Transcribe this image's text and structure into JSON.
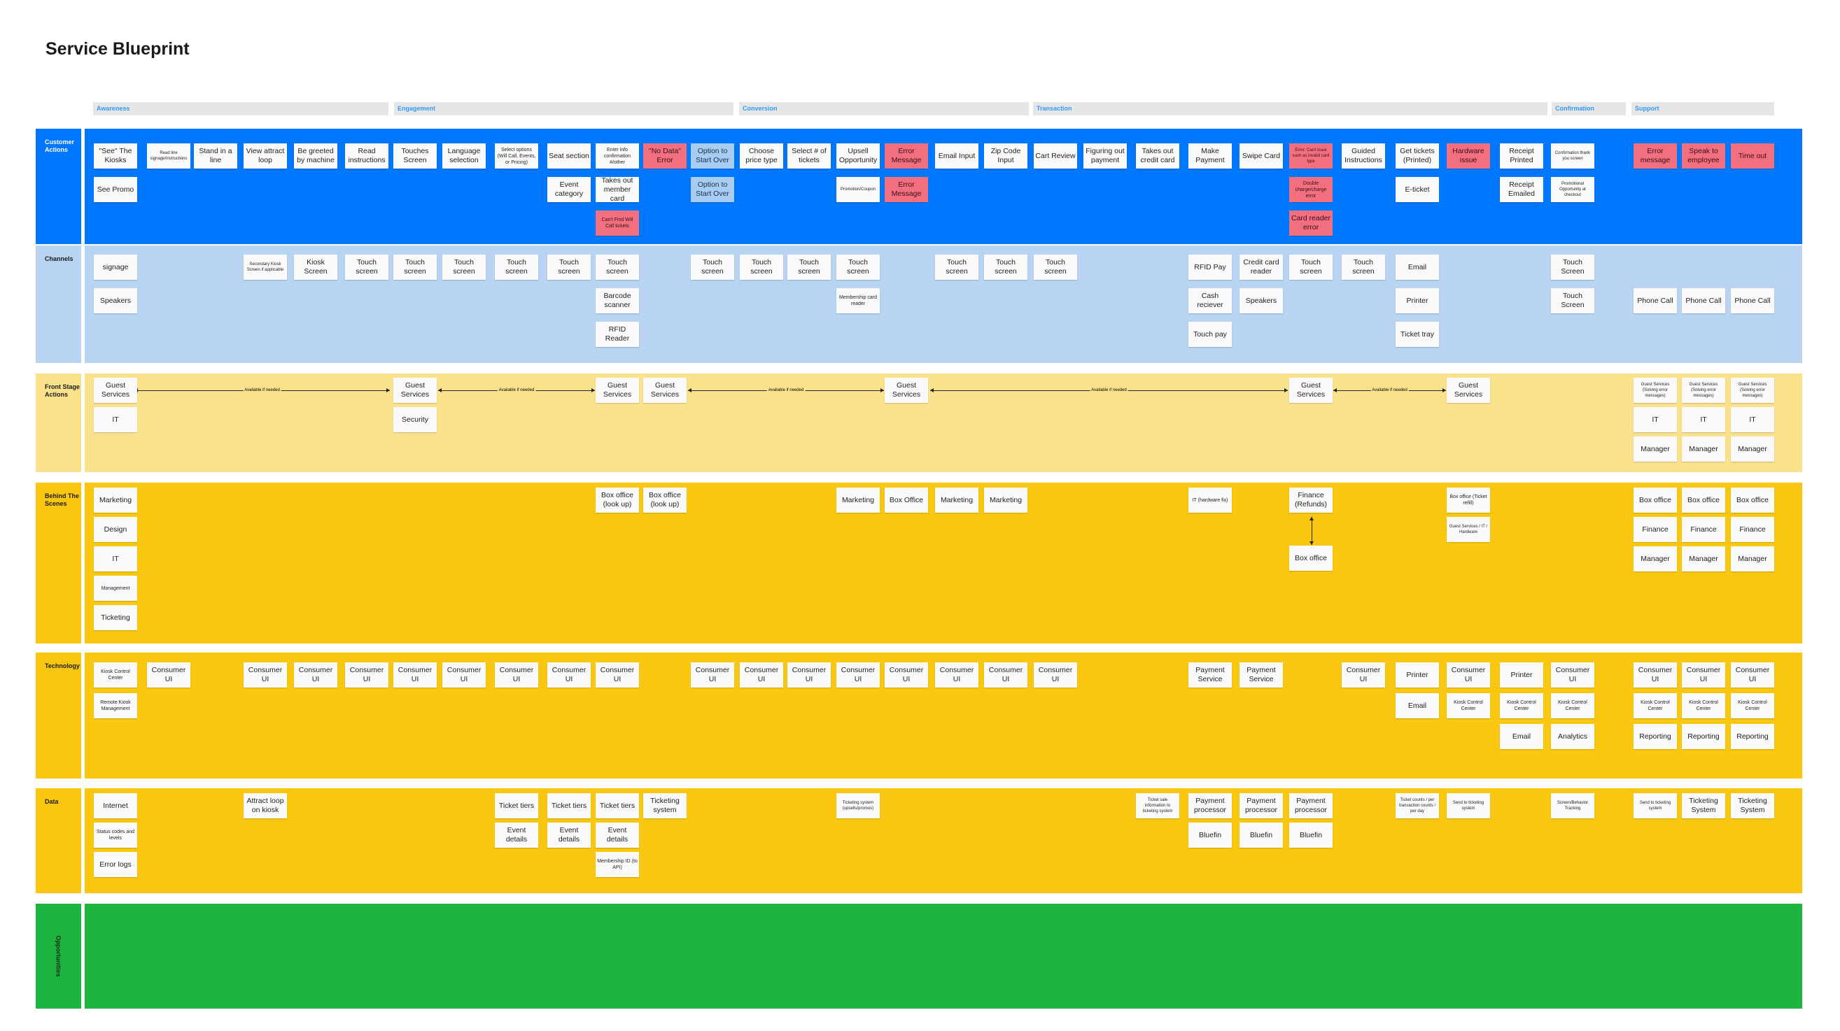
{
  "title": "Service Blueprint",
  "colors": {
    "customer_actions": "#0077ff",
    "channels": "#b9d3f2",
    "front_stage": "#fae28c",
    "behind_the_scenes": "#f9c710",
    "technology": "#f9c710",
    "data": "#f9c710",
    "opportunities": "#1db53f",
    "phase_bar": "#e6e6e6",
    "phase_text": "#2f9bff",
    "error_note": "#f26f80",
    "alt_note": "#a8cdf5"
  },
  "phases": [
    {
      "label": "Awareness"
    },
    {
      "label": "Engagement"
    },
    {
      "label": "Conversion"
    },
    {
      "label": "Transaction"
    },
    {
      "label": "Confirmation"
    },
    {
      "label": "Support"
    }
  ],
  "lanes": [
    {
      "key": "customer_actions",
      "label": "Customer Actions"
    },
    {
      "key": "channels",
      "label": "Channels"
    },
    {
      "key": "front_stage",
      "label": "Front Stage Actions"
    },
    {
      "key": "behind_the_scenes",
      "label": "Behind The Scenes"
    },
    {
      "key": "technology",
      "label": "Technology"
    },
    {
      "key": "data",
      "label": "Data"
    },
    {
      "key": "opportunities",
      "label": "Opportunities"
    }
  ],
  "connector_label": "Available if needed",
  "notes": {
    "customer_actions": [
      {
        "col": 0,
        "row": 0,
        "text": "\"See\" The Kiosks"
      },
      {
        "col": 0,
        "row": 1,
        "text": "See Promo"
      },
      {
        "col": 1,
        "row": 0,
        "text": "Read line signage/instructions",
        "size": "tiny"
      },
      {
        "col": 2,
        "row": 0,
        "text": "Stand in a line"
      },
      {
        "col": 3,
        "row": 0,
        "text": "View attract loop"
      },
      {
        "col": 4,
        "row": 0,
        "text": "Be greeted by machine"
      },
      {
        "col": 5,
        "row": 0,
        "text": "Read instructions"
      },
      {
        "col": 6,
        "row": 0,
        "text": "Touches Screen"
      },
      {
        "col": 7,
        "row": 0,
        "text": "Language selection"
      },
      {
        "col": 8,
        "row": 0,
        "text": "Select options (Will Call, Events, or Pricing)",
        "size": "small"
      },
      {
        "col": 9,
        "row": 0,
        "text": "Seat section"
      },
      {
        "col": 9,
        "row": 1,
        "text": "Event category"
      },
      {
        "col": 10,
        "row": 0,
        "text": "Enter info confirmation #/other",
        "size": "small"
      },
      {
        "col": 10,
        "row": 1,
        "text": "Takes out member card"
      },
      {
        "col": 10,
        "row": 2,
        "text": "Can't Find Will Call tickets",
        "type": "error",
        "size": "small"
      },
      {
        "col": 11,
        "row": 0,
        "text": "\"No Data\" Error",
        "type": "error"
      },
      {
        "col": 12,
        "row": 0,
        "text": "Option to Start Over",
        "type": "alt"
      },
      {
        "col": 12,
        "row": 1,
        "text": "Option to Start Over",
        "type": "alt"
      },
      {
        "col": 13,
        "row": 0,
        "text": "Choose price type"
      },
      {
        "col": 14,
        "row": 0,
        "text": "Select # of tickets"
      },
      {
        "col": 15,
        "row": 0,
        "text": "Upsell Opportunity"
      },
      {
        "col": 15,
        "row": 1,
        "text": "Promotion/Coupon",
        "size": "tiny"
      },
      {
        "col": 16,
        "row": 0,
        "text": "Error Message",
        "type": "error"
      },
      {
        "col": 16,
        "row": 1,
        "text": "Error Message",
        "type": "error"
      },
      {
        "col": 17,
        "row": 0,
        "text": "Email Input"
      },
      {
        "col": 18,
        "row": 0,
        "text": "Zip Code Input"
      },
      {
        "col": 19,
        "row": 0,
        "text": "Cart Review"
      },
      {
        "col": 20,
        "row": 0,
        "text": "Figuring out payment"
      },
      {
        "col": 21,
        "row": 0,
        "text": "Takes out credit card"
      },
      {
        "col": 22,
        "row": 0,
        "text": "Make Payment"
      },
      {
        "col": 23,
        "row": 0,
        "text": "Swipe Card"
      },
      {
        "col": 24,
        "row": 0,
        "text": "Error: Card issue such as invalid card type",
        "type": "error",
        "size": "tiny"
      },
      {
        "col": 24,
        "row": 1,
        "text": "Double charge/charge error",
        "type": "error",
        "size": "small"
      },
      {
        "col": 24,
        "row": 2,
        "text": "Card reader error",
        "type": "error"
      },
      {
        "col": 25,
        "row": 0,
        "text": "Guided Instructions"
      },
      {
        "col": 26,
        "row": 0,
        "text": "Get tickets (Printed)"
      },
      {
        "col": 26,
        "row": 1,
        "text": "E-ticket"
      },
      {
        "col": 27,
        "row": 0,
        "text": "Hardware issue",
        "type": "error"
      },
      {
        "col": 28,
        "row": 0,
        "text": "Receipt Printed"
      },
      {
        "col": 28,
        "row": 1,
        "text": "Receipt Emailed"
      },
      {
        "col": 29,
        "row": 0,
        "text": "Confirmation thank you screen",
        "size": "tiny"
      },
      {
        "col": 29,
        "row": 1,
        "text": "Promotional Opportunity at checkout",
        "size": "tiny"
      },
      {
        "col": 30,
        "row": 0,
        "text": "Error message",
        "type": "error"
      },
      {
        "col": 31,
        "row": 0,
        "text": "Speak to employee",
        "type": "error"
      },
      {
        "col": 32,
        "row": 0,
        "text": "Time out",
        "type": "error"
      }
    ],
    "channels": [
      {
        "col": 0,
        "row": 0,
        "text": "signage"
      },
      {
        "col": 0,
        "row": 1,
        "text": "Speakers"
      },
      {
        "col": 3,
        "row": 0,
        "text": "Secondary Kiosk Screen if applicable",
        "size": "tiny"
      },
      {
        "col": 4,
        "row": 0,
        "text": "Kiosk Screen"
      },
      {
        "col": 5,
        "row": 0,
        "text": "Touch screen"
      },
      {
        "col": 6,
        "row": 0,
        "text": "Touch screen"
      },
      {
        "col": 7,
        "row": 0,
        "text": "Touch screen"
      },
      {
        "col": 8,
        "row": 0,
        "text": "Touch screen"
      },
      {
        "col": 9,
        "row": 0,
        "text": "Touch screen"
      },
      {
        "col": 10,
        "row": 0,
        "text": "Touch screen"
      },
      {
        "col": 10,
        "row": 1,
        "text": "Barcode scanner"
      },
      {
        "col": 10,
        "row": 2,
        "text": "RFID Reader"
      },
      {
        "col": 12,
        "row": 0,
        "text": "Touch screen"
      },
      {
        "col": 13,
        "row": 0,
        "text": "Touch screen"
      },
      {
        "col": 14,
        "row": 0,
        "text": "Touch screen"
      },
      {
        "col": 15,
        "row": 0,
        "text": "Touch screen"
      },
      {
        "col": 15,
        "row": 1,
        "text": "Membership card reader",
        "size": "small"
      },
      {
        "col": 17,
        "row": 0,
        "text": "Touch screen"
      },
      {
        "col": 18,
        "row": 0,
        "text": "Touch screen"
      },
      {
        "col": 19,
        "row": 0,
        "text": "Touch screen"
      },
      {
        "col": 22,
        "row": 0,
        "text": "RFID Pay"
      },
      {
        "col": 22,
        "row": 1,
        "text": "Cash reciever"
      },
      {
        "col": 22,
        "row": 2,
        "text": "Touch pay"
      },
      {
        "col": 23,
        "row": 0,
        "text": "Credit card reader"
      },
      {
        "col": 23,
        "row": 1,
        "text": "Speakers"
      },
      {
        "col": 24,
        "row": 0,
        "text": "Touch screen"
      },
      {
        "col": 25,
        "row": 0,
        "text": "Touch screen"
      },
      {
        "col": 26,
        "row": 0,
        "text": "Email"
      },
      {
        "col": 26,
        "row": 1,
        "text": "Printer"
      },
      {
        "col": 26,
        "row": 2,
        "text": "Ticket tray"
      },
      {
        "col": 29,
        "row": 0,
        "text": "Touch Screen"
      },
      {
        "col": 29,
        "row": 1,
        "text": "Touch Screen"
      },
      {
        "col": 30,
        "row": 1,
        "text": "Phone Call"
      },
      {
        "col": 31,
        "row": 1,
        "text": "Phone Call"
      },
      {
        "col": 32,
        "row": 1,
        "text": "Phone Call"
      }
    ],
    "front_stage": [
      {
        "col": 0,
        "row": 0,
        "text": "Guest Services"
      },
      {
        "col": 0,
        "row": 1,
        "text": "IT"
      },
      {
        "col": 6,
        "row": 0,
        "text": "Guest Services"
      },
      {
        "col": 6,
        "row": 1,
        "text": "Security"
      },
      {
        "col": 10,
        "row": 0,
        "text": "Guest Services"
      },
      {
        "col": 11,
        "row": 0,
        "text": "Guest Services"
      },
      {
        "col": 16,
        "row": 0,
        "text": "Guest Services"
      },
      {
        "col": 24,
        "row": 0,
        "text": "Guest Services"
      },
      {
        "col": 27,
        "row": 0,
        "text": "Guest Services"
      },
      {
        "col": 30,
        "row": 0,
        "text": "Guest Services (Solving error messages)",
        "size": "tiny"
      },
      {
        "col": 30,
        "row": 1,
        "text": "IT"
      },
      {
        "col": 30,
        "row": 2,
        "text": "Manager"
      },
      {
        "col": 31,
        "row": 0,
        "text": "Guest Services (Solving error messages)",
        "size": "tiny"
      },
      {
        "col": 31,
        "row": 1,
        "text": "IT"
      },
      {
        "col": 31,
        "row": 2,
        "text": "Manager"
      },
      {
        "col": 32,
        "row": 0,
        "text": "Guest Services (Solving error messages)",
        "size": "tiny"
      },
      {
        "col": 32,
        "row": 1,
        "text": "IT"
      },
      {
        "col": 32,
        "row": 2,
        "text": "Manager"
      }
    ],
    "behind_the_scenes": [
      {
        "col": 0,
        "row": 0,
        "text": "Marketing"
      },
      {
        "col": 0,
        "row": 1,
        "text": "Design"
      },
      {
        "col": 0,
        "row": 2,
        "text": "IT"
      },
      {
        "col": 0,
        "row": 3,
        "text": "Management",
        "size": "small"
      },
      {
        "col": 0,
        "row": 4,
        "text": "Ticketing"
      },
      {
        "col": 10,
        "row": 0,
        "text": "Box office (look up)"
      },
      {
        "col": 11,
        "row": 0,
        "text": "Box office (look up)"
      },
      {
        "col": 15,
        "row": 0,
        "text": "Marketing"
      },
      {
        "col": 16,
        "row": 0,
        "text": "Box Office"
      },
      {
        "col": 17,
        "row": 0,
        "text": "Marketing"
      },
      {
        "col": 18,
        "row": 0,
        "text": "Marketing"
      },
      {
        "col": 22,
        "row": 0,
        "text": "IT (hardware fix)",
        "size": "small"
      },
      {
        "col": 24,
        "row": 0,
        "text": "Finance (Refunds)"
      },
      {
        "col": 24,
        "row": 2,
        "text": "Box office"
      },
      {
        "col": 27,
        "row": 0,
        "text": "Box office (Ticket refill)",
        "size": "small"
      },
      {
        "col": 27,
        "row": 1,
        "text": "Guest Services / IT / Hardware",
        "size": "tiny"
      },
      {
        "col": 30,
        "row": 0,
        "text": "Box office"
      },
      {
        "col": 30,
        "row": 1,
        "text": "Finance"
      },
      {
        "col": 30,
        "row": 2,
        "text": "Manager"
      },
      {
        "col": 31,
        "row": 0,
        "text": "Box office"
      },
      {
        "col": 31,
        "row": 1,
        "text": "Finance"
      },
      {
        "col": 31,
        "row": 2,
        "text": "Manager"
      },
      {
        "col": 32,
        "row": 0,
        "text": "Box office"
      },
      {
        "col": 32,
        "row": 1,
        "text": "Finance"
      },
      {
        "col": 32,
        "row": 2,
        "text": "Manager"
      }
    ],
    "technology": [
      {
        "col": 0,
        "row": 0,
        "text": "Kiosk Control Center",
        "size": "small"
      },
      {
        "col": 0,
        "row": 1,
        "text": "Remote Kiosk Management",
        "size": "small"
      },
      {
        "col": 1,
        "row": 0,
        "text": "Consumer UI"
      },
      {
        "col": 3,
        "row": 0,
        "text": "Consumer UI"
      },
      {
        "col": 4,
        "row": 0,
        "text": "Consumer UI"
      },
      {
        "col": 5,
        "row": 0,
        "text": "Consumer UI"
      },
      {
        "col": 6,
        "row": 0,
        "text": "Consumer UI"
      },
      {
        "col": 7,
        "row": 0,
        "text": "Consumer UI"
      },
      {
        "col": 8,
        "row": 0,
        "text": "Consumer UI"
      },
      {
        "col": 9,
        "row": 0,
        "text": "Consumer UI"
      },
      {
        "col": 10,
        "row": 0,
        "text": "Consumer UI"
      },
      {
        "col": 12,
        "row": 0,
        "text": "Consumer UI"
      },
      {
        "col": 13,
        "row": 0,
        "text": "Consumer UI"
      },
      {
        "col": 14,
        "row": 0,
        "text": "Consumer UI"
      },
      {
        "col": 15,
        "row": 0,
        "text": "Consumer UI"
      },
      {
        "col": 16,
        "row": 0,
        "text": "Consumer UI"
      },
      {
        "col": 17,
        "row": 0,
        "text": "Consumer UI"
      },
      {
        "col": 18,
        "row": 0,
        "text": "Consumer UI"
      },
      {
        "col": 19,
        "row": 0,
        "text": "Consumer UI"
      },
      {
        "col": 22,
        "row": 0,
        "text": "Payment Service"
      },
      {
        "col": 23,
        "row": 0,
        "text": "Payment Service"
      },
      {
        "col": 25,
        "row": 0,
        "text": "Consumer UI"
      },
      {
        "col": 26,
        "row": 0,
        "text": "Printer"
      },
      {
        "col": 26,
        "row": 1,
        "text": "Email"
      },
      {
        "col": 27,
        "row": 0,
        "text": "Consumer UI"
      },
      {
        "col": 27,
        "row": 1,
        "text": "Kiosk Control Center",
        "size": "small"
      },
      {
        "col": 28,
        "row": 0,
        "text": "Printer"
      },
      {
        "col": 28,
        "row": 1,
        "text": "Kiosk Control Center",
        "size": "small"
      },
      {
        "col": 28,
        "row": 2,
        "text": "Email"
      },
      {
        "col": 29,
        "row": 0,
        "text": "Consumer UI"
      },
      {
        "col": 29,
        "row": 1,
        "text": "Kiosk Control Center",
        "size": "small"
      },
      {
        "col": 29,
        "row": 2,
        "text": "Analytics"
      },
      {
        "col": 30,
        "row": 0,
        "text": "Consumer UI"
      },
      {
        "col": 30,
        "row": 1,
        "text": "Kiosk Control Center",
        "size": "small"
      },
      {
        "col": 30,
        "row": 2,
        "text": "Reporting"
      },
      {
        "col": 31,
        "row": 0,
        "text": "Consumer UI"
      },
      {
        "col": 31,
        "row": 1,
        "text": "Kiosk Control Center",
        "size": "small"
      },
      {
        "col": 31,
        "row": 2,
        "text": "Reporting"
      },
      {
        "col": 32,
        "row": 0,
        "text": "Consumer UI"
      },
      {
        "col": 32,
        "row": 1,
        "text": "Kiosk Control Center",
        "size": "small"
      },
      {
        "col": 32,
        "row": 2,
        "text": "Reporting"
      }
    ],
    "data": [
      {
        "col": 0,
        "row": 0,
        "text": "Internet"
      },
      {
        "col": 0,
        "row": 1,
        "text": "Status codes and levels",
        "size": "small"
      },
      {
        "col": 0,
        "row": 2,
        "text": "Error logs"
      },
      {
        "col": 3,
        "row": 0,
        "text": "Attract loop on kiosk"
      },
      {
        "col": 8,
        "row": 0,
        "text": "Ticket tiers"
      },
      {
        "col": 8,
        "row": 1,
        "text": "Event details"
      },
      {
        "col": 9,
        "row": 0,
        "text": "Ticket tiers"
      },
      {
        "col": 9,
        "row": 1,
        "text": "Event details"
      },
      {
        "col": 10,
        "row": 0,
        "text": "Ticket tiers"
      },
      {
        "col": 10,
        "row": 1,
        "text": "Event details"
      },
      {
        "col": 10,
        "row": 2,
        "text": "Membership ID (to API)",
        "size": "small"
      },
      {
        "col": 11,
        "row": 0,
        "text": "Ticketing system"
      },
      {
        "col": 15,
        "row": 0,
        "text": "Ticketing system (upsells/promos)",
        "size": "tiny"
      },
      {
        "col": 21,
        "row": 0,
        "text": "Ticket sale information to ticketing system",
        "size": "tiny"
      },
      {
        "col": 22,
        "row": 0,
        "text": "Payment processor"
      },
      {
        "col": 22,
        "row": 1,
        "text": "Bluefin"
      },
      {
        "col": 23,
        "row": 0,
        "text": "Payment processor"
      },
      {
        "col": 23,
        "row": 1,
        "text": "Bluefin"
      },
      {
        "col": 24,
        "row": 0,
        "text": "Payment processor"
      },
      {
        "col": 24,
        "row": 1,
        "text": "Bluefin"
      },
      {
        "col": 26,
        "row": 0,
        "text": "Ticket counts / per transaction counts / per day",
        "size": "tiny"
      },
      {
        "col": 27,
        "row": 0,
        "text": "Send to ticketing system",
        "size": "tiny"
      },
      {
        "col": 29,
        "row": 0,
        "text": "Screen/Behavior Tracking",
        "size": "tiny"
      },
      {
        "col": 30,
        "row": 0,
        "text": "Send to ticketing system",
        "size": "tiny"
      },
      {
        "col": 31,
        "row": 0,
        "text": "Ticketing System"
      },
      {
        "col": 32,
        "row": 0,
        "text": "Ticketing System"
      }
    ],
    "opportunities": []
  }
}
